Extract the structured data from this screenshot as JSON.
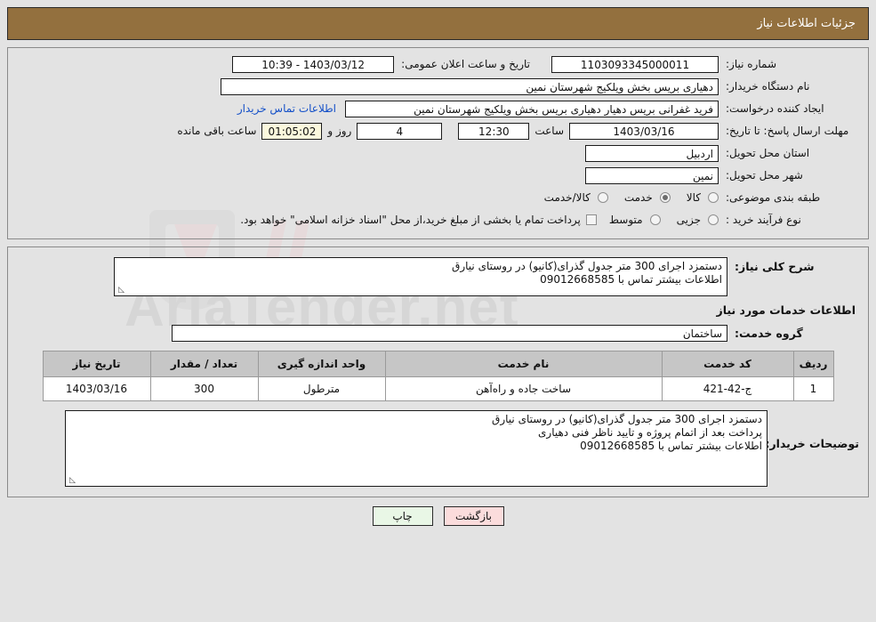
{
  "header": {
    "title": "جزئیات اطلاعات نیاز"
  },
  "info": {
    "need_number_label": "شماره نیاز:",
    "need_number_value": "1103093345000011",
    "public_announce_label": "تاریخ و ساعت اعلان عمومی:",
    "public_announce_value": "1403/03/12 - 10:39",
    "buyer_org_label": "نام دستگاه خریدار:",
    "buyer_org_value": "دهیاری بریس بخش ویلکیج شهرستان نمین",
    "creator_label": "ایجاد کننده درخواست:",
    "creator_value": "فرید غفرانی بریس دهیار دهیاری بریس بخش ویلکیج شهرستان نمین",
    "contact_link": "اطلاعات تماس خریدار",
    "deadline_label": "مهلت ارسال پاسخ: تا تاریخ:",
    "deadline_date": "1403/03/16",
    "hour_label": "ساعت",
    "deadline_time": "12:30",
    "days_value": "4",
    "days_label": "روز و",
    "countdown_value": "01:05:02",
    "remaining_label": "ساعت باقی مانده",
    "province_label": "استان محل تحویل:",
    "province_value": "اردبیل",
    "city_label": "شهر محل تحویل:",
    "city_value": "نمین",
    "category_label": "طبقه بندی موضوعی:",
    "category_options": [
      "کالا",
      "خدمت",
      "کالا/خدمت"
    ],
    "category_selected": 1,
    "process_label": "نوع فرآیند خرید :",
    "process_options": [
      "جزیی",
      "متوسط"
    ],
    "process_selected": -1,
    "treasury_note": "پرداخت تمام یا بخشی از مبلغ خرید،از محل \"اسناد خزانه اسلامی\" خواهد بود."
  },
  "need_desc": {
    "label": "شرح کلی نیاز:",
    "line1": "دستمزد اجرای 300 متر جدول گذرای(کانیو) در روستای نیارق",
    "line2": "اطلاعات بیشتر تماس با 09012668585"
  },
  "services": {
    "section_title": "اطلاعات خدمات مورد نیاز",
    "group_label": "گروه خدمت:",
    "group_value": "ساختمان",
    "columns": [
      "ردیف",
      "کد خدمت",
      "نام خدمت",
      "واحد اندازه گیری",
      "تعداد / مقدار",
      "تاریخ نیاز"
    ],
    "rows": [
      {
        "index": "1",
        "code": "ج-42-421",
        "name": "ساخت جاده و راه‌آهن",
        "unit": "مترطول",
        "quantity": "300",
        "need_date": "1403/03/16"
      }
    ]
  },
  "buyer_notes": {
    "label": "توضیحات خریدار:",
    "line1": "دستمزد اجرای 300 متر جدول گذرای(کانیو) در روستای نیارق",
    "line2": "پرداخت بعد از اتمام پروژه و تایید ناظر فنی دهیاری",
    "line3": "اطلاعات بیشتر تماس با 09012668585"
  },
  "buttons": {
    "print": "چاپ",
    "back": "بازگشت"
  },
  "watermark": {
    "text": "AriaTender.net"
  },
  "colors": {
    "header_bg": "#93703e",
    "link": "#1450c8",
    "countdown_bg": "#fbf8dd",
    "print_bg": "#e9f7e6",
    "back_bg": "#fbdcdc"
  }
}
